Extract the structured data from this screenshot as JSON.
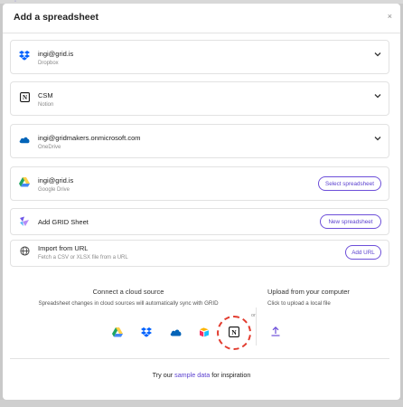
{
  "modal": {
    "title": "Add a spreadsheet",
    "close_glyph": "×"
  },
  "sources": [
    {
      "name": "ingi@grid.is",
      "sub": "Dropbox",
      "icon": "dropbox-icon"
    },
    {
      "name": "CSM",
      "sub": "Notion",
      "icon": "notion-icon"
    },
    {
      "name": "ingi@gridmakers.onmicrosoft.com",
      "sub": "OneDrive",
      "icon": "onedrive-icon"
    },
    {
      "name": "ingi@grid.is",
      "sub": "Google Drive",
      "icon": "google-drive-icon",
      "action": "Select spreadsheet"
    },
    {
      "name": "Add GRID Sheet",
      "icon": "grid-icon",
      "action": "New spreadsheet"
    },
    {
      "name": "Import from URL",
      "sub": "Fetch a CSV or XLSX file from a URL",
      "icon": "globe-icon",
      "action": "Add URL"
    }
  ],
  "connect": {
    "title": "Connect a cloud source",
    "subtitle": "Spreadsheet changes in cloud sources will automatically sync with GRID",
    "or": "or",
    "upload_title": "Upload from your computer",
    "upload_subtitle": "Click to upload a local file"
  },
  "footer": {
    "prefix": "Try our ",
    "link": "sample data",
    "suffix": " for inspiration"
  },
  "colors": {
    "accent": "#5a3fcf",
    "highlight_ring": "#e23b2e"
  }
}
